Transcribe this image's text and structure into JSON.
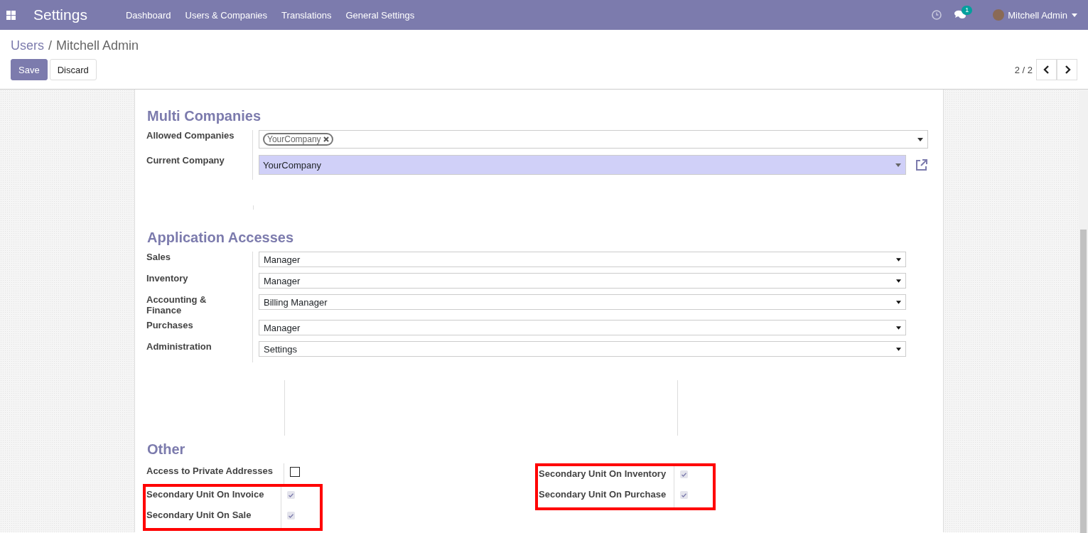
{
  "navbar": {
    "app_title": "Settings",
    "menu": [
      {
        "label": "Dashboard"
      },
      {
        "label": "Users & Companies"
      },
      {
        "label": "Translations"
      },
      {
        "label": "General Settings"
      }
    ],
    "message_count": "1",
    "user_name": "Mitchell Admin"
  },
  "breadcrumb": [
    {
      "label": "Users",
      "kind": "link"
    },
    {
      "label": "/",
      "kind": "separator"
    },
    {
      "label": "Mitchell Admin",
      "kind": "current"
    }
  ],
  "buttons": [
    {
      "label": "Save",
      "kind": "primary"
    },
    {
      "label": "Discard",
      "kind": "secondary"
    }
  ],
  "pager": {
    "text": "2 / 2"
  },
  "multi_companies": {
    "title": "Multi Companies",
    "allowed_label": "Allowed Companies",
    "allowed_tags": [
      "YourCompany"
    ],
    "current_label": "Current Company",
    "current_value": "YourCompany"
  },
  "application_accesses": {
    "title": "Application Accesses",
    "rows": [
      {
        "label": "Sales",
        "value": "Manager"
      },
      {
        "label": "Inventory",
        "value": "Manager"
      },
      {
        "label": "Accounting & Finance",
        "value": "Billing Manager"
      },
      {
        "label": "Purchases",
        "value": "Manager"
      },
      {
        "label": "Administration",
        "value": "Settings"
      }
    ]
  },
  "other": {
    "title": "Other",
    "columns": [
      {
        "rows": [
          {
            "label": "Access to Private Addresses",
            "checked": false,
            "highlighted": false
          },
          {
            "label": "Secondary Unit On Invoice",
            "checked": true,
            "highlighted": true
          },
          {
            "label": "Secondary Unit On Sale",
            "checked": true,
            "highlighted": true
          }
        ]
      },
      {
        "rows": [
          {
            "label": "Secondary Unit On Inventory",
            "checked": true,
            "highlighted": true
          },
          {
            "label": "Secondary Unit On Purchase",
            "checked": true,
            "highlighted": true
          }
        ]
      }
    ]
  }
}
